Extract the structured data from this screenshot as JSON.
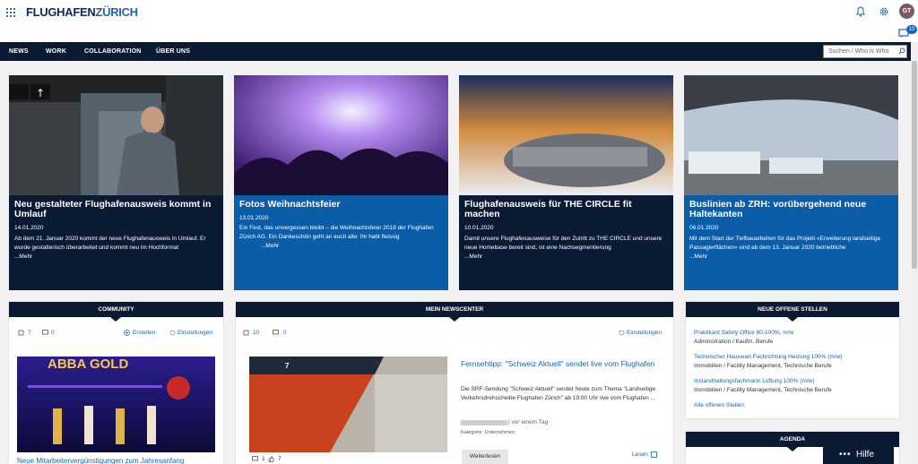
{
  "header": {
    "logo_main": "FLUGHAFEN",
    "logo_accent": "ZÜRICH",
    "avatar_initials": "GT",
    "chat_badge": "10"
  },
  "nav": {
    "items": [
      "NEWS",
      "WORK",
      "COLLABORATION",
      "ÜBER UNS"
    ],
    "search_placeholder": "Suchen / Who is Who"
  },
  "news": [
    {
      "title": "Neu gestalteter Flughafenausweis kommt in Umlauf",
      "date": "14.01.2020",
      "text": "Ab dem 21. Januar 2020 kommt der neue Flughafenausweis in Umlauf. Er wurde gestalterisch überarbeitet und kommt neu im Hochformat",
      "more": "...Mehr"
    },
    {
      "title": "Fotos Weihnachtsfeier",
      "date": "13.01.2020",
      "text": "Ein Fest, das unvergessen bleibt – die Weihnachtsfeier 2019 der Flughafen Zürich AG. Ein Dankeschön geht an euch alle: Ihr habt fleissig",
      "more": "...Mehr"
    },
    {
      "title": "Flughafenausweis für THE CIRCLE fit machen",
      "date": "10.01.2020",
      "text": "Damit unsere Flughafenausweise für den Zutritt zu THE CIRCLE und unsere neue Homebase bereit sind, ist eine Nachsegmentierung",
      "more": "...Mehr"
    },
    {
      "title": "Buslinien ab ZRH: vorübergehend neue Haltekanten",
      "date": "06.01.2020",
      "text": "Mit dem Start der Tiefbauarbeiten für das Projekt «Erweiterung landseitige Passagierflächen» sind ab dem 13. Januar 2020 betriebliche",
      "more": "...Mehr"
    }
  ],
  "community": {
    "heading": "COMMUNITY",
    "likes": "7",
    "comments": "0",
    "create": "Erstellen",
    "settings": "Einstellungen",
    "poster_text": "ABBA GOLD",
    "post_title": "Neue Mitarbeitervergünstigungen zum Jahresanfang"
  },
  "newscenter": {
    "heading": "MEIN NEWSCENTER",
    "likes": "10",
    "comments": "0",
    "settings": "Einstellungen",
    "train_number": "7",
    "article_title": "Fernsehtipp: \"Schweiz Aktuell\" sendet live vom Flughafen",
    "article_text": "Die SRF-Sendung \"Schweiz Aktuell\" sendet heute zum Thema \"Landseitige Verkehrsdrehscheibe Flughafen Zürich\" ab 19:00 Uhr live vom Flughafen ...",
    "meta": "| vor einem Tag",
    "category": "Kategorie: Unternehmen",
    "read_more": "Weiterlesen",
    "read_label": "Lesen",
    "footer_comments": "1",
    "footer_likes": "7"
  },
  "jobs": {
    "heading": "NEUE OFFENE STELLEN",
    "items": [
      {
        "title": "Praktikant Safety Office 80-100%, m/w",
        "category": "Administration / Kaufm. Berufe"
      },
      {
        "title": "Technischer Hauswart Fachrichtung Heizung 100% (m/w)",
        "category": "Immobilien / Facility Management, Technische Berufe"
      },
      {
        "title": "Instandhaltungsfachmann Lüftung 100% (m/w)",
        "category": "Immobilien / Facility Management, Technische Berufe"
      }
    ],
    "all": "Alle offenen Stellen"
  },
  "agenda": {
    "heading": "AGENDA"
  },
  "help": {
    "label": "Hilfe",
    "dots": "•••"
  },
  "colors": {
    "navy": "#0b1a33",
    "blue": "#0a5da6",
    "link": "#1a64b4"
  }
}
